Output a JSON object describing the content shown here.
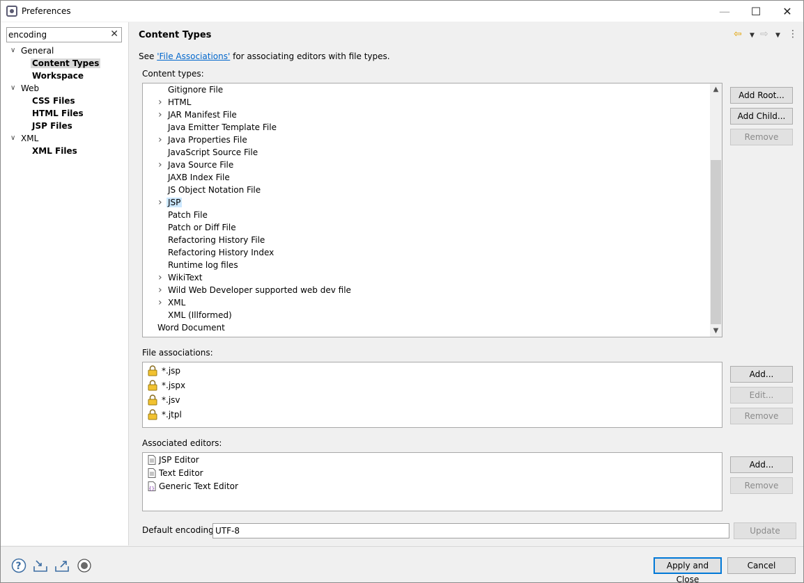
{
  "window": {
    "title": "Preferences"
  },
  "filter": {
    "value": "encoding"
  },
  "tree": [
    {
      "label": "General",
      "expanded": true,
      "children": [
        "Content Types",
        "Workspace"
      ]
    },
    {
      "label": "Web",
      "expanded": true,
      "children": [
        "CSS Files",
        "HTML Files",
        "JSP Files"
      ]
    },
    {
      "label": "XML",
      "expanded": true,
      "children": [
        "XML Files"
      ]
    }
  ],
  "tree_labels": {
    "general": "General",
    "content_types": "Content Types",
    "workspace": "Workspace",
    "web": "Web",
    "css_files": "CSS Files",
    "html_files": "HTML Files",
    "jsp_files": "JSP Files",
    "xml": "XML",
    "xml_files": "XML Files"
  },
  "page": {
    "title": "Content Types",
    "see_prefix": "See ",
    "see_link": "'File Associations'",
    "see_suffix": " for associating editors with file types.",
    "content_types_label": "Content types:",
    "file_assoc_label": "File associations:",
    "assoc_editors_label": "Associated editors:",
    "default_encoding_label": "Default encoding:",
    "default_encoding_value": "UTF-8"
  },
  "content_types": [
    {
      "label": "Gitignore File",
      "expandable": false
    },
    {
      "label": "HTML",
      "expandable": true
    },
    {
      "label": "JAR Manifest File",
      "expandable": true
    },
    {
      "label": "Java Emitter Template File",
      "expandable": false
    },
    {
      "label": "Java Properties File",
      "expandable": true
    },
    {
      "label": "JavaScript Source File",
      "expandable": false
    },
    {
      "label": "Java Source File",
      "expandable": true
    },
    {
      "label": "JAXB Index File",
      "expandable": false
    },
    {
      "label": "JS Object Notation File",
      "expandable": false
    },
    {
      "label": "JSP",
      "expandable": true,
      "selected": true
    },
    {
      "label": "Patch File",
      "expandable": false
    },
    {
      "label": "Patch or Diff File",
      "expandable": false
    },
    {
      "label": "Refactoring History File",
      "expandable": false
    },
    {
      "label": "Refactoring History Index",
      "expandable": false
    },
    {
      "label": "Runtime log files",
      "expandable": false
    },
    {
      "label": "WikiText",
      "expandable": true
    },
    {
      "label": "Wild Web Developer supported web dev file",
      "expandable": true
    },
    {
      "label": "XML",
      "expandable": true
    },
    {
      "label": "XML (Illformed)",
      "expandable": false
    },
    {
      "label": "Word Document",
      "expandable": false,
      "root": true
    }
  ],
  "content_type_buttons": {
    "add_root": "Add Root...",
    "add_child": "Add Child...",
    "remove": "Remove"
  },
  "file_associations": [
    "*.jsp",
    "*.jspx",
    "*.jsv",
    "*.jtpl"
  ],
  "file_assoc_buttons": {
    "add": "Add...",
    "edit": "Edit...",
    "remove": "Remove"
  },
  "associated_editors": [
    {
      "label": "JSP Editor",
      "icon": "jsp-editor-icon"
    },
    {
      "label": "Text Editor",
      "icon": "text-editor-icon"
    },
    {
      "label": "Generic Text Editor",
      "icon": "generic-text-editor-icon"
    }
  ],
  "editor_buttons": {
    "add": "Add...",
    "remove": "Remove"
  },
  "update_button": "Update",
  "footer": {
    "apply_close": "Apply and Close",
    "cancel": "Cancel"
  },
  "colors": {
    "link": "#0066cc",
    "selection": "#cce8ff",
    "primary_border": "#0078d7"
  }
}
